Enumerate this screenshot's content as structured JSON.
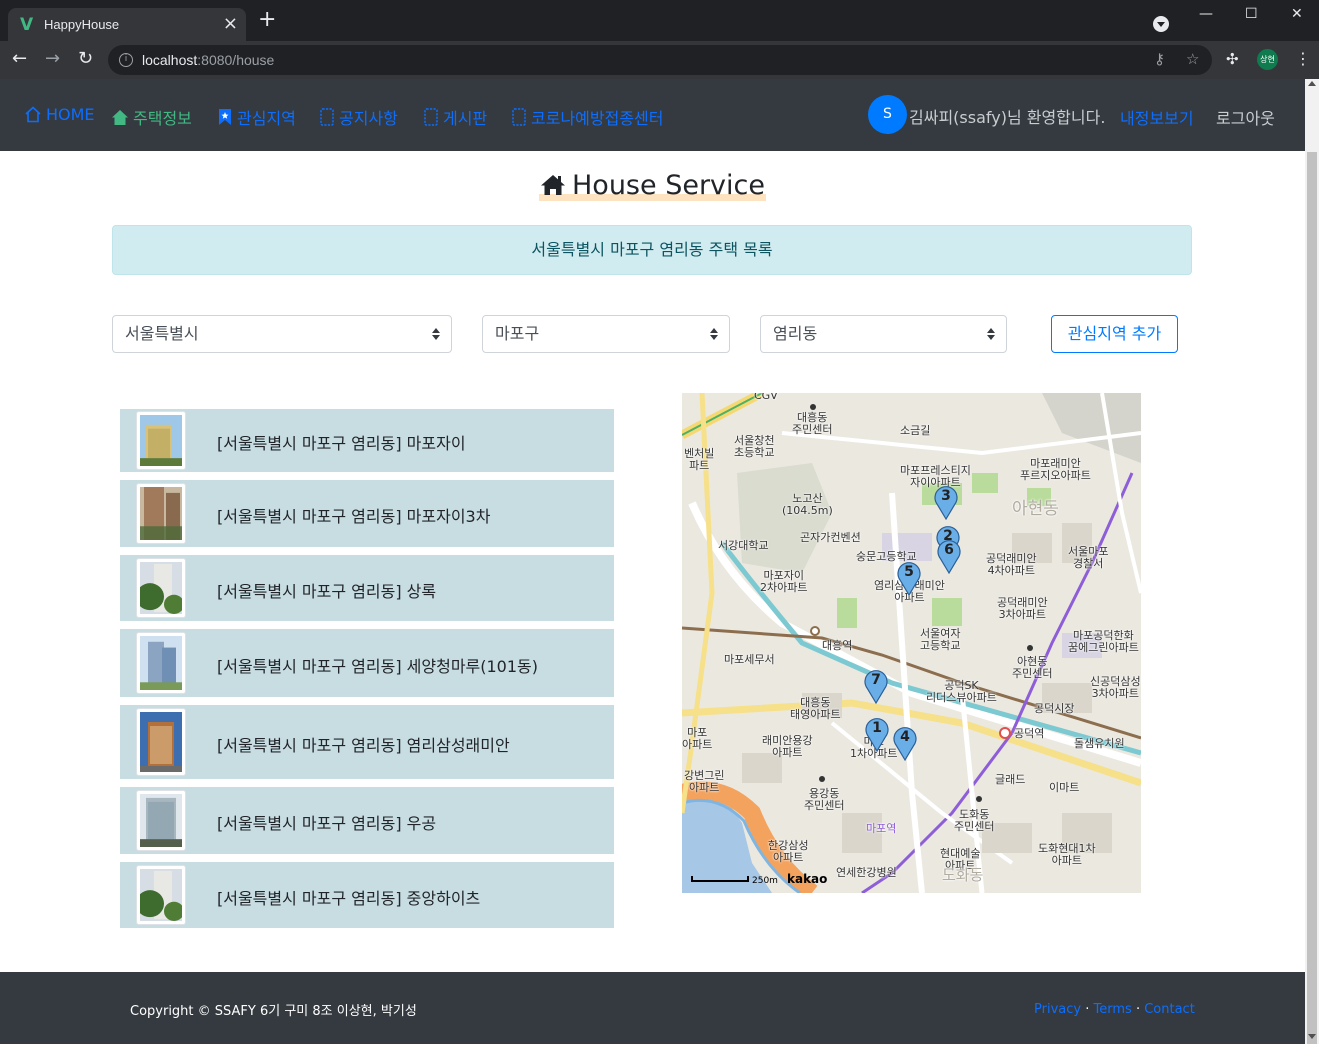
{
  "browser": {
    "tab_title": "HappyHouse",
    "tab_favicon": "V",
    "url_host": "localhost",
    "url_rest": ":8080/house",
    "profile_initials": "상현"
  },
  "navbar": {
    "items": [
      {
        "label": "HOME",
        "icon": "home-outline-icon",
        "active": false
      },
      {
        "label": "주택정보",
        "icon": "house-fill-icon",
        "active": true
      },
      {
        "label": "관심지역",
        "icon": "bookmark-icon",
        "active": false
      },
      {
        "label": "공지사항",
        "icon": "journal-icon",
        "active": false
      },
      {
        "label": "게시판",
        "icon": "journal-icon",
        "active": false
      },
      {
        "label": "코로나예방접종센터",
        "icon": "journal-icon",
        "active": false
      }
    ],
    "avatar_letter": "S",
    "welcome": "김싸피(ssafy)님 환영합니다.",
    "my_info": "내정보보기",
    "logout": "로그아웃",
    "colors": {
      "bg": "#343a40",
      "link": "#0d6efd",
      "active": "#42b983"
    }
  },
  "main": {
    "title": "House Service",
    "alert": "서울특별시 마포구 염리동 주택 목록",
    "filters": {
      "city": "서울특별시",
      "gu": "마포구",
      "dong": "염리동",
      "add_button": "관심지역 추가"
    },
    "houses": [
      {
        "name": "[서울특별시 마포구 염리동] 마포자이"
      },
      {
        "name": "[서울특별시 마포구 염리동] 마포자이3차"
      },
      {
        "name": "[서울특별시 마포구 염리동] 상록"
      },
      {
        "name": "[서울특별시 마포구 염리동] 세양청마루(101동)"
      },
      {
        "name": "[서울특별시 마포구 염리동] 염리삼성래미안"
      },
      {
        "name": "[서울특별시 마포구 염리동] 우공"
      },
      {
        "name": "[서울특별시 마포구 염리동] 중앙하이츠"
      }
    ]
  },
  "map": {
    "provider": "kakao",
    "scale": "250m",
    "markers": [
      "1",
      "2",
      "3",
      "4",
      "5",
      "6",
      "7"
    ],
    "labels": {
      "l1": "대흥동\n주민센터",
      "l2": "소금길",
      "l3": "서울창천\n초등학교",
      "l4": "마포프레스티지\n자이아파트",
      "l5": "마포래미안\n푸르지오아파트",
      "l6": "노고산\n(104.5m)",
      "l7": "서강대학교",
      "l8": "곤자가컨벤션",
      "l9": "숭문고등학교",
      "l10": "마포자이\n2차아파트",
      "l11": "염리삼성래미안\n아파트",
      "l12": "공덕래미안\n4차아파트",
      "l13": "서울마포\n경찰서",
      "l14": "공덕래미안\n3차아파트",
      "l15": "대흥역",
      "l16": "서울여자\n고등학교",
      "l17": "마포세무서",
      "l18": "아현동\n주민센터",
      "l19": "마포공덕한화\n꿈에그린아파트",
      "l20": "공덕SK\n리더스뷰아파트",
      "l21": "대흥동\n태영아파트",
      "l22": "신공덕삼성\n3차아파트",
      "l23": "공덕시장",
      "l24": "래미안용강\n아파트",
      "l25": "마포\n1차아파트",
      "l26": "공덕역",
      "l27": "돌샘유치원",
      "l28": "강변그린\n아파트",
      "l29": "용강동\n주민센터",
      "l30": "글래드",
      "l31": "이마트",
      "l32": "도화동\n주민센터",
      "l33": "한강삼성\n아파트",
      "l34": "현대예술\n아파트",
      "l35": "도화현대1차\n아파트",
      "l36": "연세한강병원",
      "l37": "CGV",
      "l38": "벤처빌\n파트",
      "l39": "마포\n아파트",
      "l40": "아현동",
      "l41": "마포역",
      "l42": "도화동"
    }
  },
  "footer": {
    "copyright": "Copyright © SSAFY 6기 구미 8조 이상현, 박기성",
    "privacy": "Privacy",
    "terms": "Terms",
    "contact": "Contact",
    "sep": "·"
  }
}
